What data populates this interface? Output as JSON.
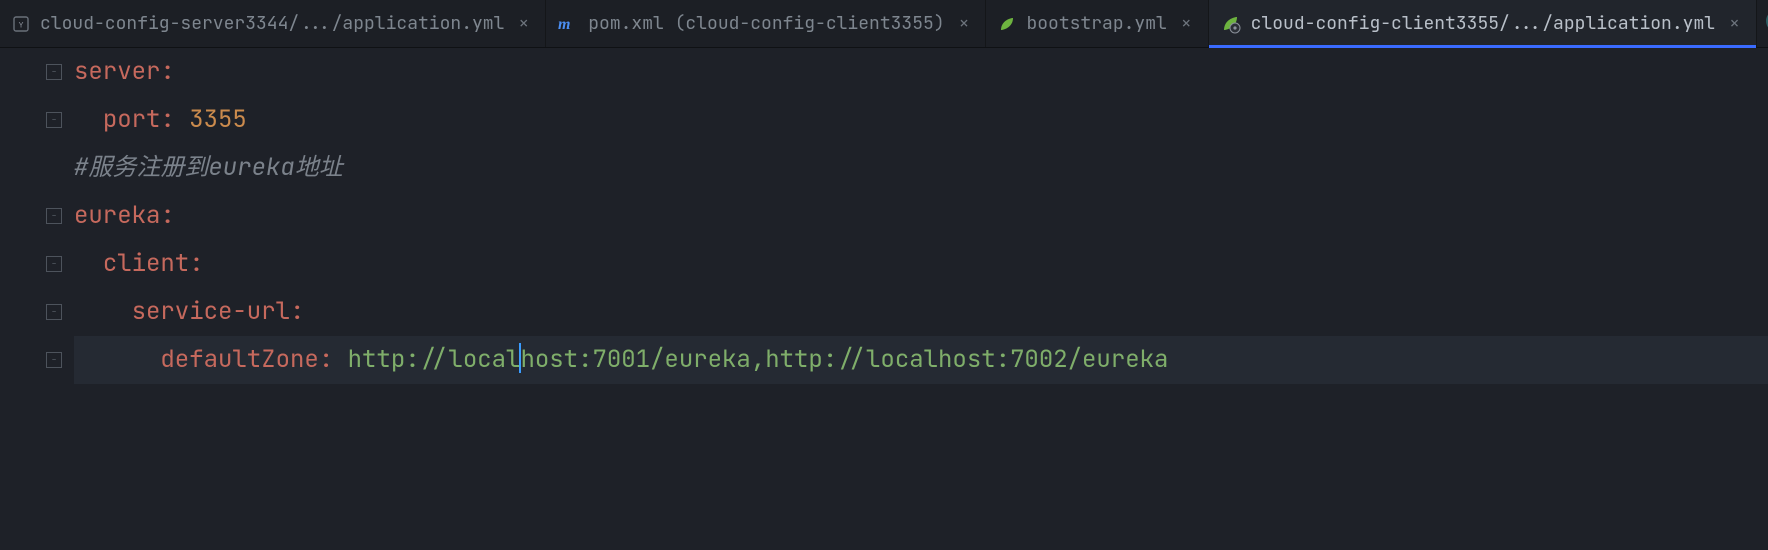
{
  "tabs": [
    {
      "label": "cloud-config-server3344/.../application.yml",
      "icon": "yml"
    },
    {
      "label": "pom.xml (cloud-config-client3355)",
      "icon": "maven"
    },
    {
      "label": "bootstrap.yml",
      "icon": "spring"
    },
    {
      "label": "cloud-config-client3355/.../application.yml",
      "icon": "spring-active",
      "active": true
    }
  ],
  "close_glyph": "×",
  "fold_minus": "−",
  "code": {
    "l1_key": "server",
    "l2_key": "port",
    "l2_val": "3355",
    "l3_comment": "#服务注册到eureka地址",
    "l4_key": "eureka",
    "l5_key": "client",
    "l6_key": "service-url",
    "l7_key": "defaultZone",
    "l7_val_a": "http://local",
    "l7_val_b": "host:7001/eureka,http://localhost:7002/eureka"
  }
}
